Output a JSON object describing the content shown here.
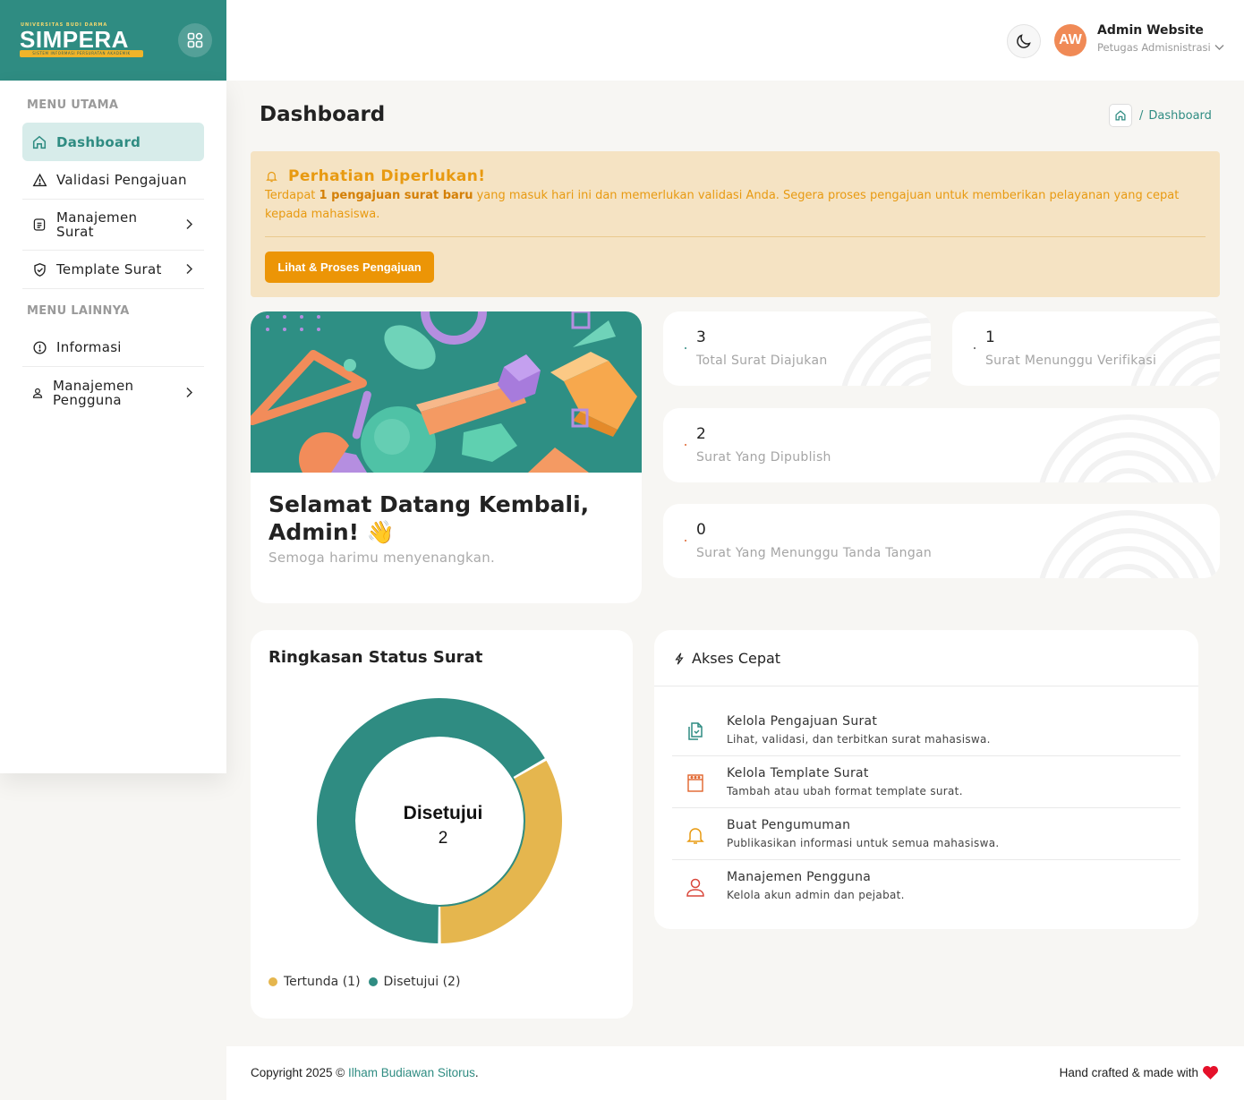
{
  "brand": {
    "university": "UNIVERSITAS BUDI DARMA",
    "name": "SIMPERA",
    "subtitle": "SISTEM INFORMASI PERSURATAN AKADEMIK"
  },
  "sidebar": {
    "sections": [
      {
        "heading": "MENU UTAMA"
      },
      {
        "heading": "MENU LAINNYA"
      }
    ],
    "items": [
      {
        "label": "Dashboard",
        "icon": "home-icon",
        "active": true
      },
      {
        "label": "Validasi Pengajuan",
        "icon": "warning-icon"
      },
      {
        "label": "Manajemen Surat",
        "icon": "document-icon",
        "has_submenu": true
      },
      {
        "label": "Template Surat",
        "icon": "shield-check-icon",
        "has_submenu": true
      },
      {
        "label": "Informasi",
        "icon": "info-icon"
      },
      {
        "label": "Manajemen Pengguna",
        "icon": "user-icon",
        "has_submenu": true
      }
    ]
  },
  "topbar": {
    "avatar_initials": "AW",
    "user_name": "Admin Website",
    "user_role": "Petugas Admisnistrasi"
  },
  "page": {
    "title": "Dashboard",
    "breadcrumb": "Dashboard"
  },
  "alert": {
    "title": "Perhatian Diperlukan!",
    "text_before": "Terdapat ",
    "text_bold": "1 pengajuan surat baru",
    "text_after": " yang masuk hari ini dan memerlukan validasi Anda. Segera proses pengajuan untuk memberikan pelayanan yang cepat kepada mahasiswa.",
    "button": "Lihat & Proses Pengajuan"
  },
  "welcome": {
    "heading": "Selamat Datang Kembali, Admin! 👋",
    "subtext": "Semoga harimu menyenangkan."
  },
  "stats": [
    {
      "value": "3",
      "label": "Total Surat Diajukan",
      "color": "#2f8c82"
    },
    {
      "value": "1",
      "label": "Surat Menunggu Verifikasi",
      "color": "#555555"
    },
    {
      "value": "2",
      "label": "Surat Yang Dipublish",
      "color": "#e0632b"
    },
    {
      "value": "0",
      "label": "Surat Yang Menunggu Tanda Tangan",
      "color": "#e0632b"
    }
  ],
  "chart": {
    "title": "Ringkasan Status Surat",
    "center_label": "Disetujui",
    "center_value": "2"
  },
  "chart_data": {
    "type": "pie",
    "categories": [
      "Tertunda",
      "Disetujui"
    ],
    "values": [
      1,
      2
    ],
    "colors": [
      "#e5b64e",
      "#2f8c82"
    ],
    "legend": [
      "Tertunda (1)",
      "Disetujui (2)"
    ],
    "legend_position": "bottom-left"
  },
  "quick": {
    "title": "Akses Cepat",
    "items": [
      {
        "title": "Kelola Pengajuan Surat",
        "desc": "Lihat, validasi, dan terbitkan surat mahasiswa.",
        "icon": "documents-icon",
        "color": "#2f8c82"
      },
      {
        "title": "Kelola Template Surat",
        "desc": "Tambah atau ubah format template surat.",
        "icon": "template-icon",
        "color": "#e0632b"
      },
      {
        "title": "Buat Pengumuman",
        "desc": "Publikasikan informasi untuk semua mahasiswa.",
        "icon": "bell-icon",
        "color": "#e89a11"
      },
      {
        "title": "Manajemen Pengguna",
        "desc": "Kelola akun admin dan pejabat.",
        "icon": "user-icon",
        "color": "#d9463a"
      }
    ]
  },
  "footer": {
    "copyright_prefix": "Copyright 2025 © ",
    "author": "Ilham Budiawan Sitorus",
    "suffix": ".",
    "crafted": "Hand crafted & made with"
  }
}
